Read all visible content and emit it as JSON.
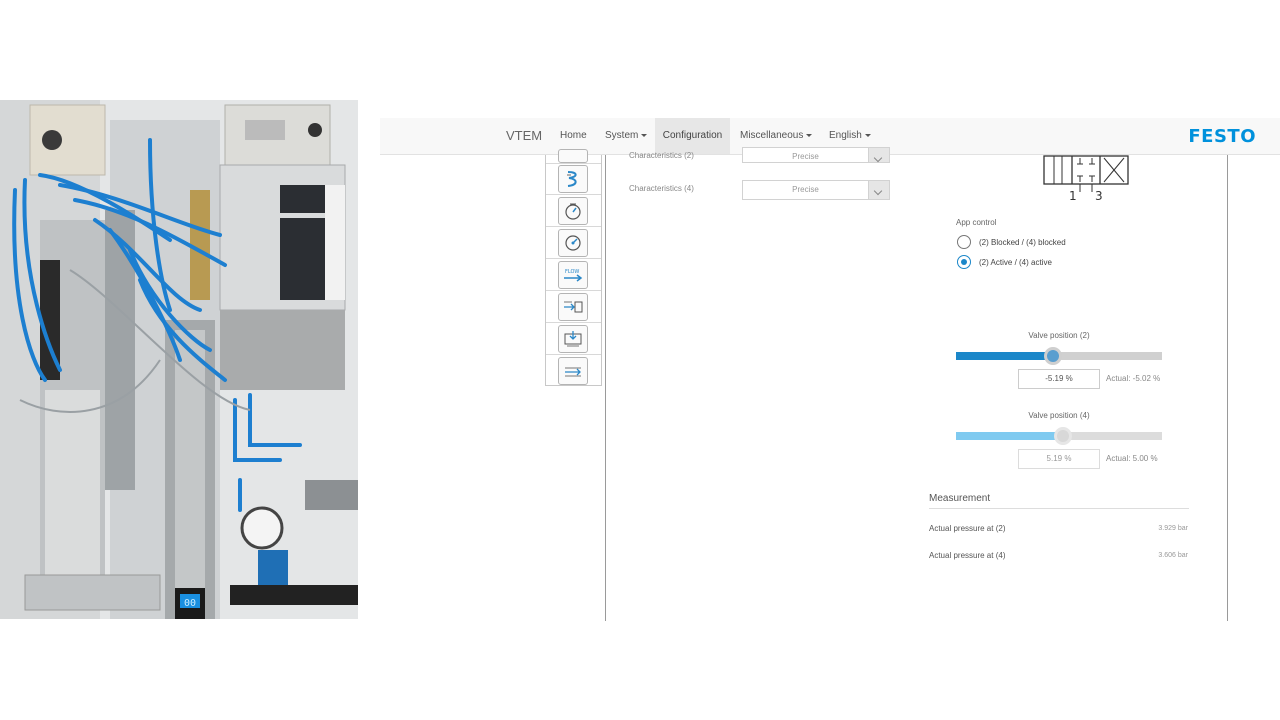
{
  "navbar": {
    "brand": "VTEM",
    "items": [
      {
        "label": "Home"
      },
      {
        "label": "System"
      },
      {
        "label": "Configuration"
      },
      {
        "label": "Miscellaneous"
      },
      {
        "label": "English"
      }
    ],
    "logo": "FESTO"
  },
  "characteristics": [
    {
      "label": "Characteristics (2)",
      "value": "Precise"
    },
    {
      "label": "Characteristics (4)",
      "value": "Precise"
    }
  ],
  "symbol_ports": {
    "left": "1",
    "right": "3"
  },
  "app_control": {
    "label": "App control",
    "options": [
      {
        "label": "(2) Blocked / (4) blocked",
        "selected": false
      },
      {
        "label": "(2) Active / (4) active",
        "selected": true
      }
    ]
  },
  "valve2": {
    "title": "Valve position (2)",
    "value": "-5.19 %",
    "actual": "Actual: -5.02 %",
    "level": 0.47
  },
  "valve4": {
    "title": "Valve position (4)",
    "value": "5.19 %",
    "actual": "Actual: 5.00 %",
    "level": 0.52
  },
  "measurement": {
    "title": "Measurement",
    "rows": [
      {
        "label": "Actual pressure at (2)",
        "value": "3.929 bar"
      },
      {
        "label": "Actual pressure at (4)",
        "value": "3.606 bar"
      }
    ]
  },
  "photo_display": "00",
  "colors": {
    "accent": "#1b87c9",
    "accent_light": "#7fcaf0",
    "festo_blue": "#0091dc"
  }
}
